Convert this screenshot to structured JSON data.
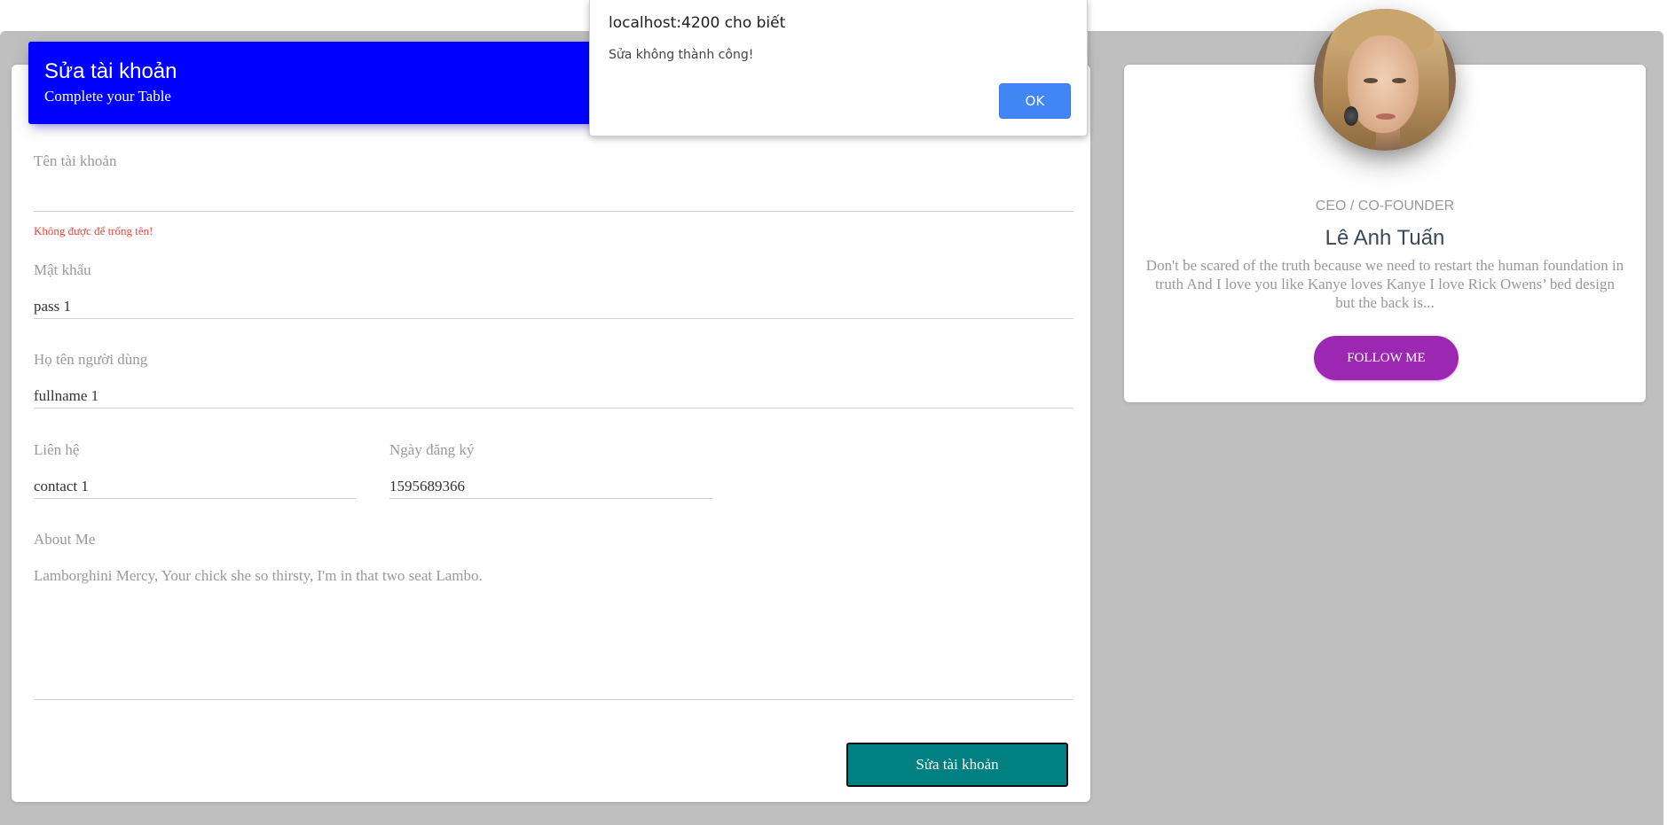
{
  "form": {
    "header": {
      "title": "Sửa tài khoản",
      "subtitle": "Complete your Table"
    },
    "fields": {
      "username": {
        "label": "Tên tài khoản",
        "value": "",
        "error": "Không được để trống tên!"
      },
      "password": {
        "label": "Mật khẩu",
        "value": "pass 1"
      },
      "fullname": {
        "label": "Họ tên người dùng",
        "value": "fullname 1"
      },
      "contact": {
        "label": "Liên hệ",
        "value": "contact 1"
      },
      "register_date": {
        "label": "Ngày đăng ký",
        "value": "1595689366"
      },
      "about": {
        "label": "About Me",
        "value": "Lamborghini Mercy, Your chick she so thirsty, I'm in that two seat Lambo."
      }
    },
    "submit_label": "Sửa tài khoản"
  },
  "profile": {
    "role": "CEO / CO-FOUNDER",
    "name": "Lê Anh Tuấn",
    "description": "Don't be scared of the truth because we need to restart the human foundation in truth And I love you like Kanye loves Kanye I love Rick Owens’ bed design but the back is...",
    "follow_label": "FOLLOW ME"
  },
  "alert": {
    "title": "localhost:4200 cho biết",
    "message": "Sửa không thành công!",
    "ok_label": "OK"
  },
  "colors": {
    "header_bg": "#0000ff",
    "submit_bg": "#008080",
    "follow_bg": "#9c27b0",
    "error": "#f44336",
    "page_bg": "#bfbfbf",
    "alert_ok_bg": "#4285f4"
  }
}
